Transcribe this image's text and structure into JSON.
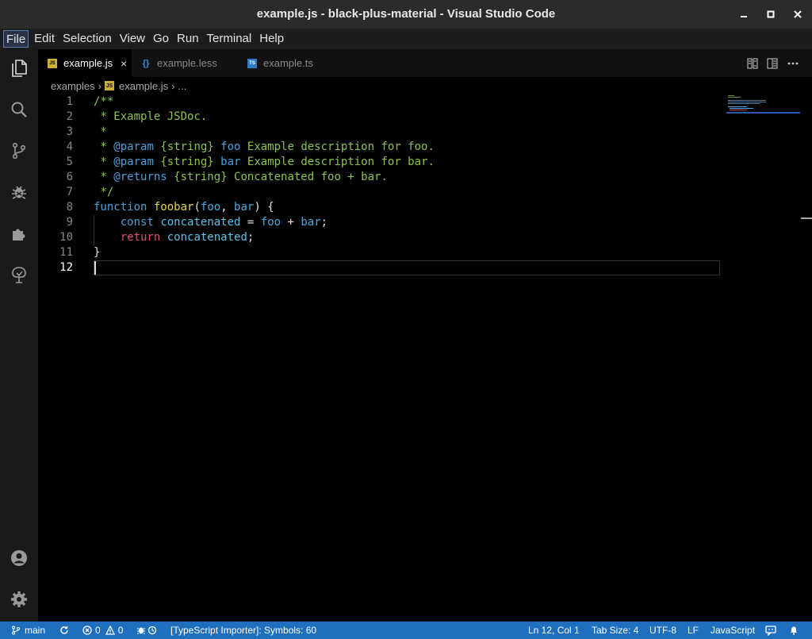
{
  "window": {
    "title": "example.js - black-plus-material - Visual Studio Code"
  },
  "menu": [
    "File",
    "Edit",
    "Selection",
    "View",
    "Go",
    "Run",
    "Terminal",
    "Help"
  ],
  "tabs": [
    {
      "label": "example.js",
      "icon": "JS",
      "active": true
    },
    {
      "label": "example.less",
      "icon": "{}",
      "active": false
    },
    {
      "label": "example.ts",
      "icon": "TS",
      "active": false
    }
  ],
  "breadcrumb": {
    "folder": "examples",
    "file": "example.js",
    "more": "..."
  },
  "editor": {
    "line_numbers": [
      "1",
      "2",
      "3",
      "4",
      "5",
      "6",
      "7",
      "8",
      "9",
      "10",
      "11",
      "12"
    ],
    "current_line": 12
  },
  "code": {
    "l1": "/**",
    "l2": " * Example JSDoc.",
    "l3": " *",
    "l4_star": " * ",
    "l4_tag": "@param",
    "l4_type": " {string} ",
    "l4_name": "foo",
    "l4_desc": " Example description for foo.",
    "l5_star": " * ",
    "l5_tag": "@param",
    "l5_type": " {string} ",
    "l5_name": "bar",
    "l5_desc": " Example description for bar.",
    "l6_star": " * ",
    "l6_tag": "@returns",
    "l6_type": " {string}",
    "l6_desc": " Concatenated foo + bar.",
    "l7": " */",
    "l8_kw": "function",
    "l8_fn": "foobar",
    "l8_open": "(",
    "l8_p1": "foo",
    "l8_comma": ", ",
    "l8_p2": "bar",
    "l8_close": ") {",
    "l9_indent": "    ",
    "l9_kw": "const",
    "l9_var": "concatenated",
    "l9_eq": " = ",
    "l9_a": "foo",
    "l9_plus": " + ",
    "l9_b": "bar",
    "l9_semi": ";",
    "l10_indent": "    ",
    "l10_kw": "return",
    "l10_var": "concatenated",
    "l10_semi": ";",
    "l11": "}"
  },
  "statusbar": {
    "branch": "main",
    "errors": "0",
    "warnings": "0",
    "importer": "[TypeScript Importer]: Symbols: 60",
    "position": "Ln 12, Col 1",
    "tab_size": "Tab Size: 4",
    "encoding": "UTF-8",
    "eol": "LF",
    "language": "JavaScript"
  },
  "colors": {
    "statusbar": "#1e6fbd",
    "comment": "#8bc34a",
    "keyword": "#4a9fda",
    "function": "#e2d74e",
    "return": "#e0506a",
    "variable": "#59c3e8"
  }
}
